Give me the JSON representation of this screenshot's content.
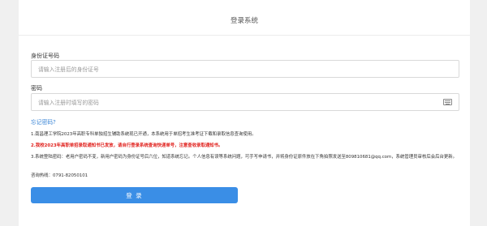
{
  "page": {
    "title": "登录系统"
  },
  "form": {
    "id_label": "身份证号码",
    "id_placeholder": "请输入注册后的身份证号",
    "password_label": "密码",
    "password_placeholder": "请输入注册时填写的密码",
    "keyboard_icon": "keyboard-icon",
    "forgot_link": "忘记密码?",
    "login_button": "登 录"
  },
  "notices": [
    "1.南昌理工学院2023年高职专科单独招生辅助系统现已开通，本系统用于单招考生准考证下载和录取信息查询使用。",
    "2.我校2023年高职单招录取通知书已发放，请自行登录系统查询快递单号，注意查收录取通知书。",
    "3.系统登陆密码：老用户密码不变，新用户密码为身份证号后六位，知道系统忘记。个人信息有误等系统问题，可手写申请书，并将身份证原件放在下角拍照发送至809810681@qq.com，系统管理员审核后会后台更新。",
    "咨询热线：0791-82050101"
  ],
  "colors": {
    "accent": "#3a8ee6",
    "warning": "#e0201c",
    "link": "#3b86d6"
  }
}
